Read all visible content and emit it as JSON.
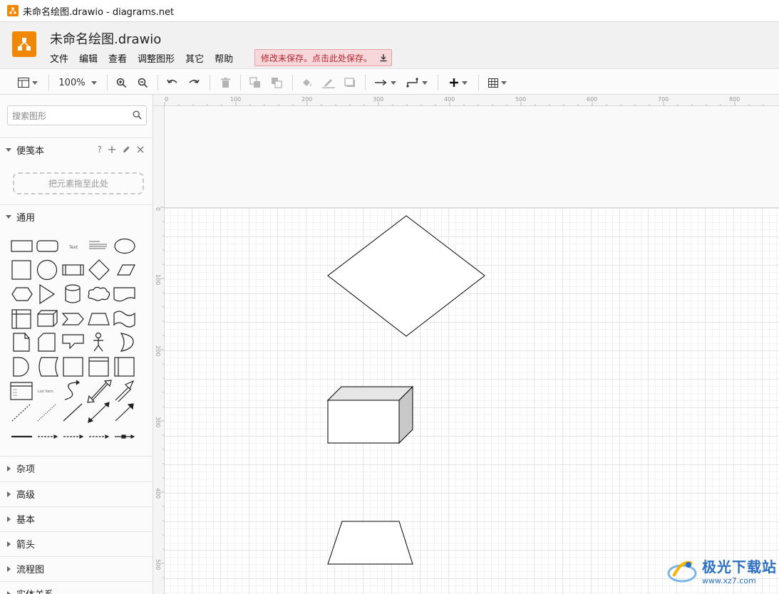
{
  "window": {
    "title": "未命名绘图.drawio - diagrams.net"
  },
  "header": {
    "filename": "未命名绘图.drawio",
    "menu": [
      "文件",
      "编辑",
      "查看",
      "调整图形",
      "其它",
      "帮助"
    ],
    "unsaved_notice": "修改未保存。点击此处保存。"
  },
  "toolbar": {
    "zoom": "100%"
  },
  "sidebar": {
    "search_placeholder": "搜索图形",
    "scratchpad": {
      "title": "便笺本",
      "help": "?",
      "drop_hint": "把元素拖至此处"
    },
    "general": {
      "title": "通用"
    },
    "collapsed_sections": [
      "杂项",
      "高级",
      "基本",
      "箭头",
      "流程图",
      "实体关系"
    ]
  },
  "rulers": {
    "top_ticks": [
      "0",
      "100",
      "200",
      "300",
      "400",
      "500",
      "600",
      "700",
      "800"
    ],
    "left_ticks": [
      "0",
      "100",
      "200",
      "300",
      "400",
      "500"
    ]
  },
  "watermark": {
    "brand": "极光下载站",
    "url": "www.xz7.com"
  },
  "colors": {
    "accent": "#f08705",
    "unsaved_bg": "#f8d7da",
    "unsaved_text": "#b3262f"
  }
}
